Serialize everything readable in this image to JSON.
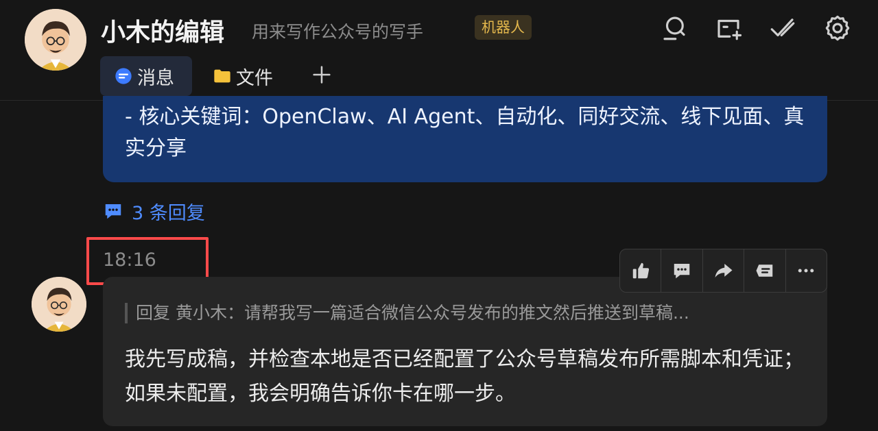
{
  "header": {
    "title": "小木的编辑",
    "subtitle": "用来写作公众号的写手",
    "badge": "机器人",
    "icons": [
      "search-icon",
      "add-window-icon",
      "check-icon",
      "settings-icon"
    ]
  },
  "tabs": [
    {
      "label": "消息",
      "icon": "message-icon",
      "active": true
    },
    {
      "label": "文件",
      "icon": "folder-icon",
      "active": false
    }
  ],
  "previous_message": {
    "text": "- 核心关键词：OpenClaw、AI Agent、自动化、同好交流、线下见面、真实分享"
  },
  "replies_label": "3 条回复",
  "message": {
    "time": "18:16",
    "quote": "回复 黄小木：请帮我写一篇适合微信公众号发布的推文然后推送到草稿...",
    "text": "我先写成稿，并检查本地是否已经配置了公众号草稿发布所需脚本和凭证；如果未配置，我会明确告诉你卡在哪一步。"
  },
  "toolbar": [
    "thumbs-up-icon",
    "comment-icon",
    "forward-icon",
    "quote-icon",
    "more-icon"
  ],
  "colors": {
    "accent": "#4f8cff",
    "bubble": "#173770",
    "badge": "#e3b74c",
    "highlight": "#ff4a4a"
  }
}
